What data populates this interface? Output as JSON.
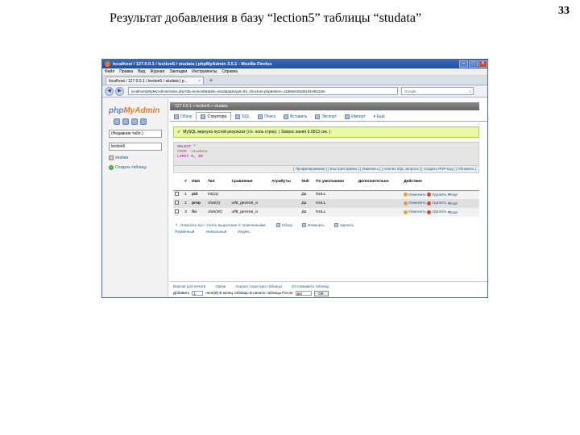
{
  "slide": {
    "title": "Результат добавления в базу “lection5” таблицы “studata”",
    "page_number": "33"
  },
  "browser": {
    "window_title": "localhost / 127.0.0.1 / lection5 / studata | phpMyAdmin 3.5.1 - Mozilla Firefox",
    "menu": [
      "Файл",
      "Правка",
      "Вид",
      "Журнал",
      "Закладки",
      "Инструменты",
      "Справка"
    ],
    "tab_label": "localhost / 127.0.0.1 / lection5 / studata | p...",
    "url": "localhost/phpMyAdmin/index.php?db=lection5&table=studata&target=tbl_structure.php&token=1188a5c58d51d4c9bcb0e",
    "search_placeholder": "Google"
  },
  "pma": {
    "logo_php": "php",
    "logo_my": "MyAdmin",
    "recent_tables": "(Недавние табл.)",
    "db_select": "lection5",
    "table_link": "studata",
    "create_table": "Создать таблицу",
    "breadcrumb": "127.0.0.1 » lection5 » studata",
    "tabs": [
      "Обзор",
      "Структура",
      "SQL",
      "Поиск",
      "Вставить",
      "Экспорт",
      "Импорт",
      "Ещё"
    ],
    "active_tab_index": 1,
    "success_message": "MySQL вернула пустой результат (т.е. ноль строк). ( Запрос занял 0.0013 сек. )",
    "sql_lines": [
      "SELECT *",
      "FROM `studata`",
      "LIMIT 0, 30"
    ],
    "sql_links": "[ Профилирование ] [ Быстрая правка ] [ Изменить ] [ Анализ SQL запроса ] [ Создать PHP-код ] [ Обновить ]",
    "columns_headers": [
      "#",
      "Имя",
      "Тип",
      "Сравнение",
      "Атрибуты",
      "Null",
      "По умолчанию",
      "Дополнительно",
      "Действие"
    ],
    "rows": [
      {
        "num": "1",
        "name": "pid",
        "type": "int(11)",
        "collation": "",
        "null": "Да",
        "default": "NULL",
        "edit": "Изменить",
        "del": "Удалить",
        "more": "Ещё"
      },
      {
        "num": "2",
        "name": "prop",
        "type": "char(4)",
        "collation": "utf8_general_ci",
        "null": "Да",
        "default": "NULL",
        "edit": "Изменить",
        "del": "Удалить",
        "more": "Ещё"
      },
      {
        "num": "3",
        "name": "fio",
        "type": "char(30)",
        "collation": "utf8_general_ci",
        "null": "Да",
        "default": "NULL",
        "edit": "Изменить",
        "del": "Удалить",
        "more": "Ещё"
      }
    ],
    "select_all": "Отметить все / Снять выделение  С отмеченными:",
    "browse_action": "Обзор",
    "change_action": "Изменить",
    "delete_action": "Удалить",
    "primary": "Первичный",
    "unique": "Уникальный",
    "index": "Индекс",
    "bottom_links": [
      "Версия для печати",
      "Связи",
      "Анализ структуры таблицы",
      "Отслеживать таблицу"
    ],
    "add_label": "Добавить",
    "add_count": "1",
    "add_rest": "поле(й)  В конец таблицы  В начало таблицы  После",
    "after_select": "pid",
    "ok": "OK"
  }
}
